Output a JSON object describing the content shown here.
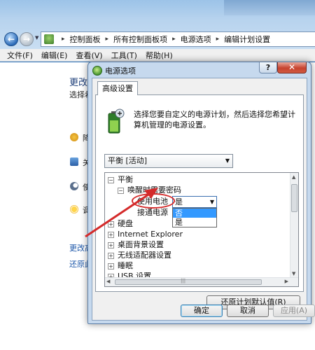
{
  "explorer": {
    "breadcrumbs": [
      "控制面板",
      "所有控制面板项",
      "电源选项",
      "编辑计划设置"
    ],
    "menu": [
      "文件(F)",
      "编辑(E)",
      "查看(V)",
      "工具(T)",
      "帮助(H)"
    ],
    "background": {
      "title": "更改",
      "desc": "选择希",
      "items": [
        "降",
        "关",
        "使",
        "调"
      ],
      "links": [
        "更改高",
        "还原此"
      ]
    }
  },
  "dialog": {
    "title": "电源选项",
    "help": "?",
    "close": "✕",
    "tab": "高级设置",
    "intro": "选择您要自定义的电源计划，然后选择您希望计算机管理的电源设置。",
    "plan": "平衡 [活动]",
    "tree": {
      "root": "平衡",
      "group": "唤醒时需要密码",
      "item1": "使用电池",
      "item2": "接通电源",
      "others": [
        "硬盘",
        "Internet Explorer",
        "桌面背景设置",
        "无线适配器设置",
        "睡眠",
        "USB 设置"
      ]
    },
    "combo_value": "是",
    "dropdown_options": [
      "否",
      "是"
    ],
    "restore_button": "还原计划默认值(R)",
    "ok": "确定",
    "cancel": "取消",
    "apply": "应用(A)"
  }
}
